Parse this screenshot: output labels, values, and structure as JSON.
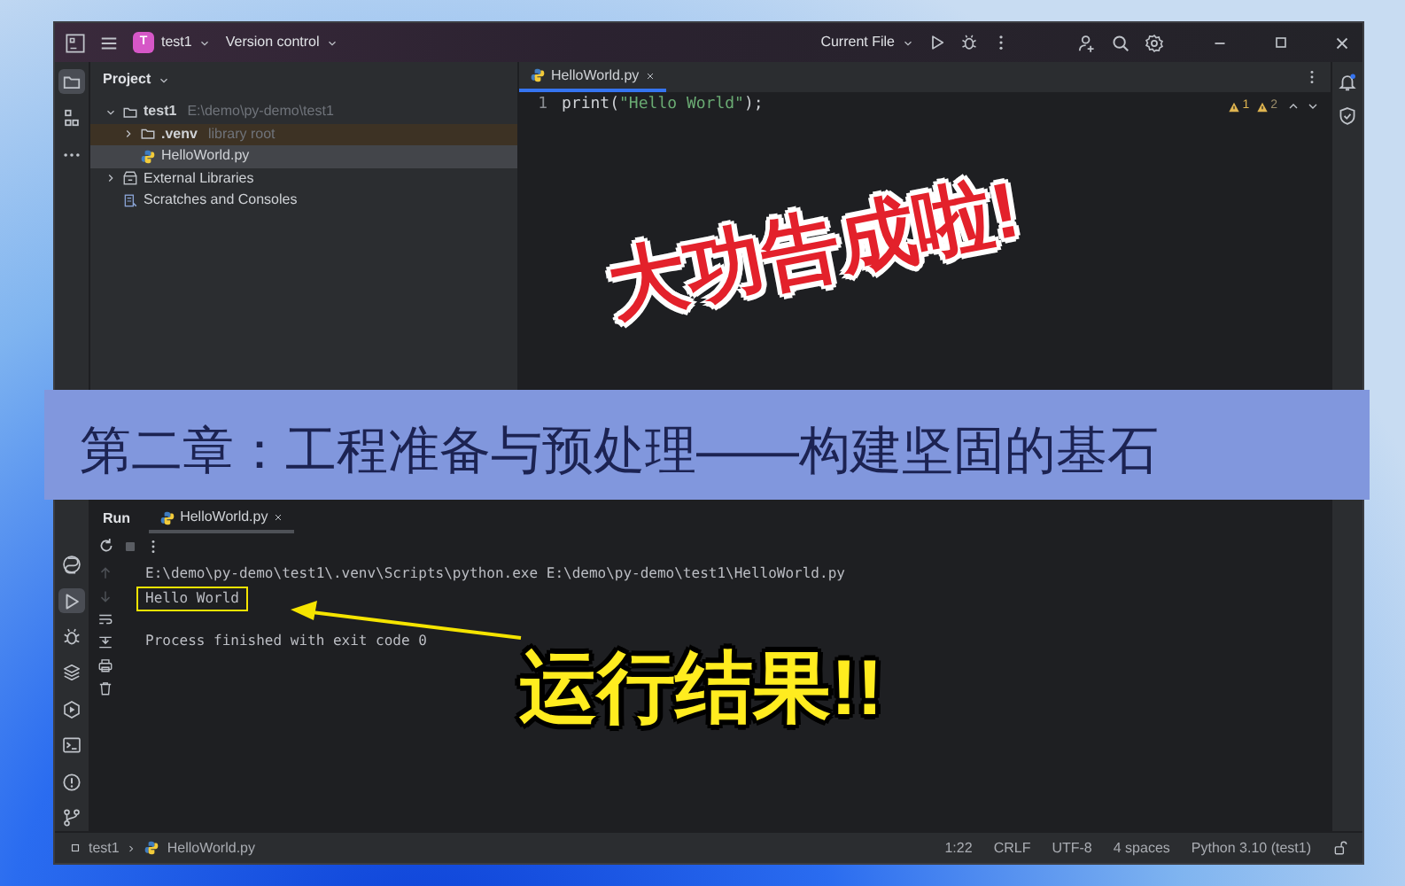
{
  "title_bar": {
    "project_badge": "T",
    "project": "test1",
    "vcs": "Version control",
    "run_config": "Current File"
  },
  "tool_strip": {
    "top": [
      {
        "kind": "project",
        "selected": true
      },
      {
        "kind": "structure",
        "selected": false
      },
      {
        "kind": "more",
        "selected": false
      }
    ],
    "bottom": [
      {
        "kind": "python_console",
        "selected": false
      },
      {
        "kind": "run",
        "selected": true
      },
      {
        "kind": "debug",
        "selected": false
      },
      {
        "kind": "layers",
        "selected": false
      },
      {
        "kind": "services",
        "selected": false
      },
      {
        "kind": "terminal",
        "selected": false
      },
      {
        "kind": "problems",
        "selected": false
      },
      {
        "kind": "git",
        "selected": false
      }
    ]
  },
  "project_panel": {
    "title": "Project",
    "tree": [
      {
        "label": "test1",
        "hint": "E:\\demo\\py-demo\\test1",
        "kind": "folder",
        "expanded": true,
        "selected": false,
        "children": [
          {
            "label": ".venv",
            "hint": "library root",
            "kind": "folder",
            "expanded": false,
            "selected": false,
            "excluded": true
          },
          {
            "label": "HelloWorld.py",
            "kind": "python",
            "selected": true
          }
        ]
      },
      {
        "label": "External Libraries",
        "kind": "library",
        "expanded": false,
        "selected": false,
        "excluded": false
      },
      {
        "label": "Scratches and Consoles",
        "kind": "scratch",
        "selected": false
      }
    ]
  },
  "editor": {
    "tabs": [
      {
        "label": "HelloWorld.py",
        "selected": true
      }
    ],
    "lines": [
      {
        "number": "1",
        "code": "print(\"Hello World\");"
      }
    ],
    "warnings": "1",
    "weak_warnings": "2"
  },
  "heading_sticker": "大功告成啦!",
  "banner": "第二章：工程准备与预处理——构建坚固的基石",
  "run_panel": {
    "title": "Run",
    "tabs": [
      {
        "label": "HelloWorld.py",
        "selected": true
      }
    ],
    "console": [
      {
        "text": "E:\\demo\\py-demo\\test1\\.venv\\Scripts\\python.exe E:\\demo\\py-demo\\test1\\HelloWorld.py",
        "kind": "command",
        "highlighted": false
      },
      {
        "text": "Hello World",
        "kind": "output",
        "highlighted": true
      },
      {
        "text": "Process finished with exit code 0",
        "kind": "exit",
        "highlighted": false
      }
    ]
  },
  "result_sticker": "运行结果!!",
  "status_bar": {
    "breadcrumbs": [
      "test1",
      "HelloWorld.py"
    ],
    "items": [
      "1:22",
      "CRLF",
      "UTF-8",
      "4 spaces",
      "Python 3.10 (test1)"
    ]
  }
}
